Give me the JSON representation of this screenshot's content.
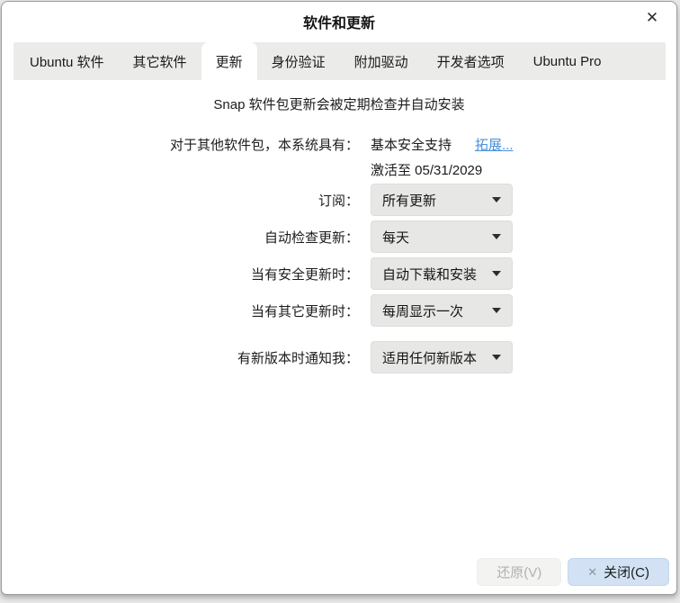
{
  "window": {
    "title": "软件和更新",
    "close_icon": "✕"
  },
  "tabs": [
    {
      "label": "Ubuntu 软件",
      "active": false
    },
    {
      "label": "其它软件",
      "active": false
    },
    {
      "label": "更新",
      "active": true
    },
    {
      "label": "身份验证",
      "active": false
    },
    {
      "label": "附加驱动",
      "active": false
    },
    {
      "label": "开发者选项",
      "active": false
    },
    {
      "label": "Ubuntu Pro",
      "active": false
    }
  ],
  "content": {
    "snap_note": "Snap 软件包更新会被定期检查并自动安装",
    "support": {
      "label": "对于其他软件包，本系统具有：",
      "value": "基本安全支持",
      "link": "拓展...",
      "active_until": "激活至 05/31/2029"
    },
    "rows": [
      {
        "label": "订阅：",
        "value": "所有更新"
      },
      {
        "label": "自动检查更新：",
        "value": "每天"
      },
      {
        "label": "当有安全更新时：",
        "value": "自动下载和安装"
      },
      {
        "label": "当有其它更新时：",
        "value": "每周显示一次"
      },
      {
        "label": "有新版本时通知我：",
        "value": "适用任何新版本"
      }
    ]
  },
  "footer": {
    "revert_label": "还原(V)",
    "close_icon": "✕",
    "close_label": "关闭(C)"
  },
  "colors": {
    "tabbar_bg": "#ebebe9",
    "active_tab_bg": "#ffffff",
    "dropdown_bg": "#e7e7e5",
    "link_blue": "#4a90d9",
    "close_button_bg": "#d2e2f4",
    "disabled_text": "#b3b1ae",
    "window_border": "#9e9e9e"
  }
}
